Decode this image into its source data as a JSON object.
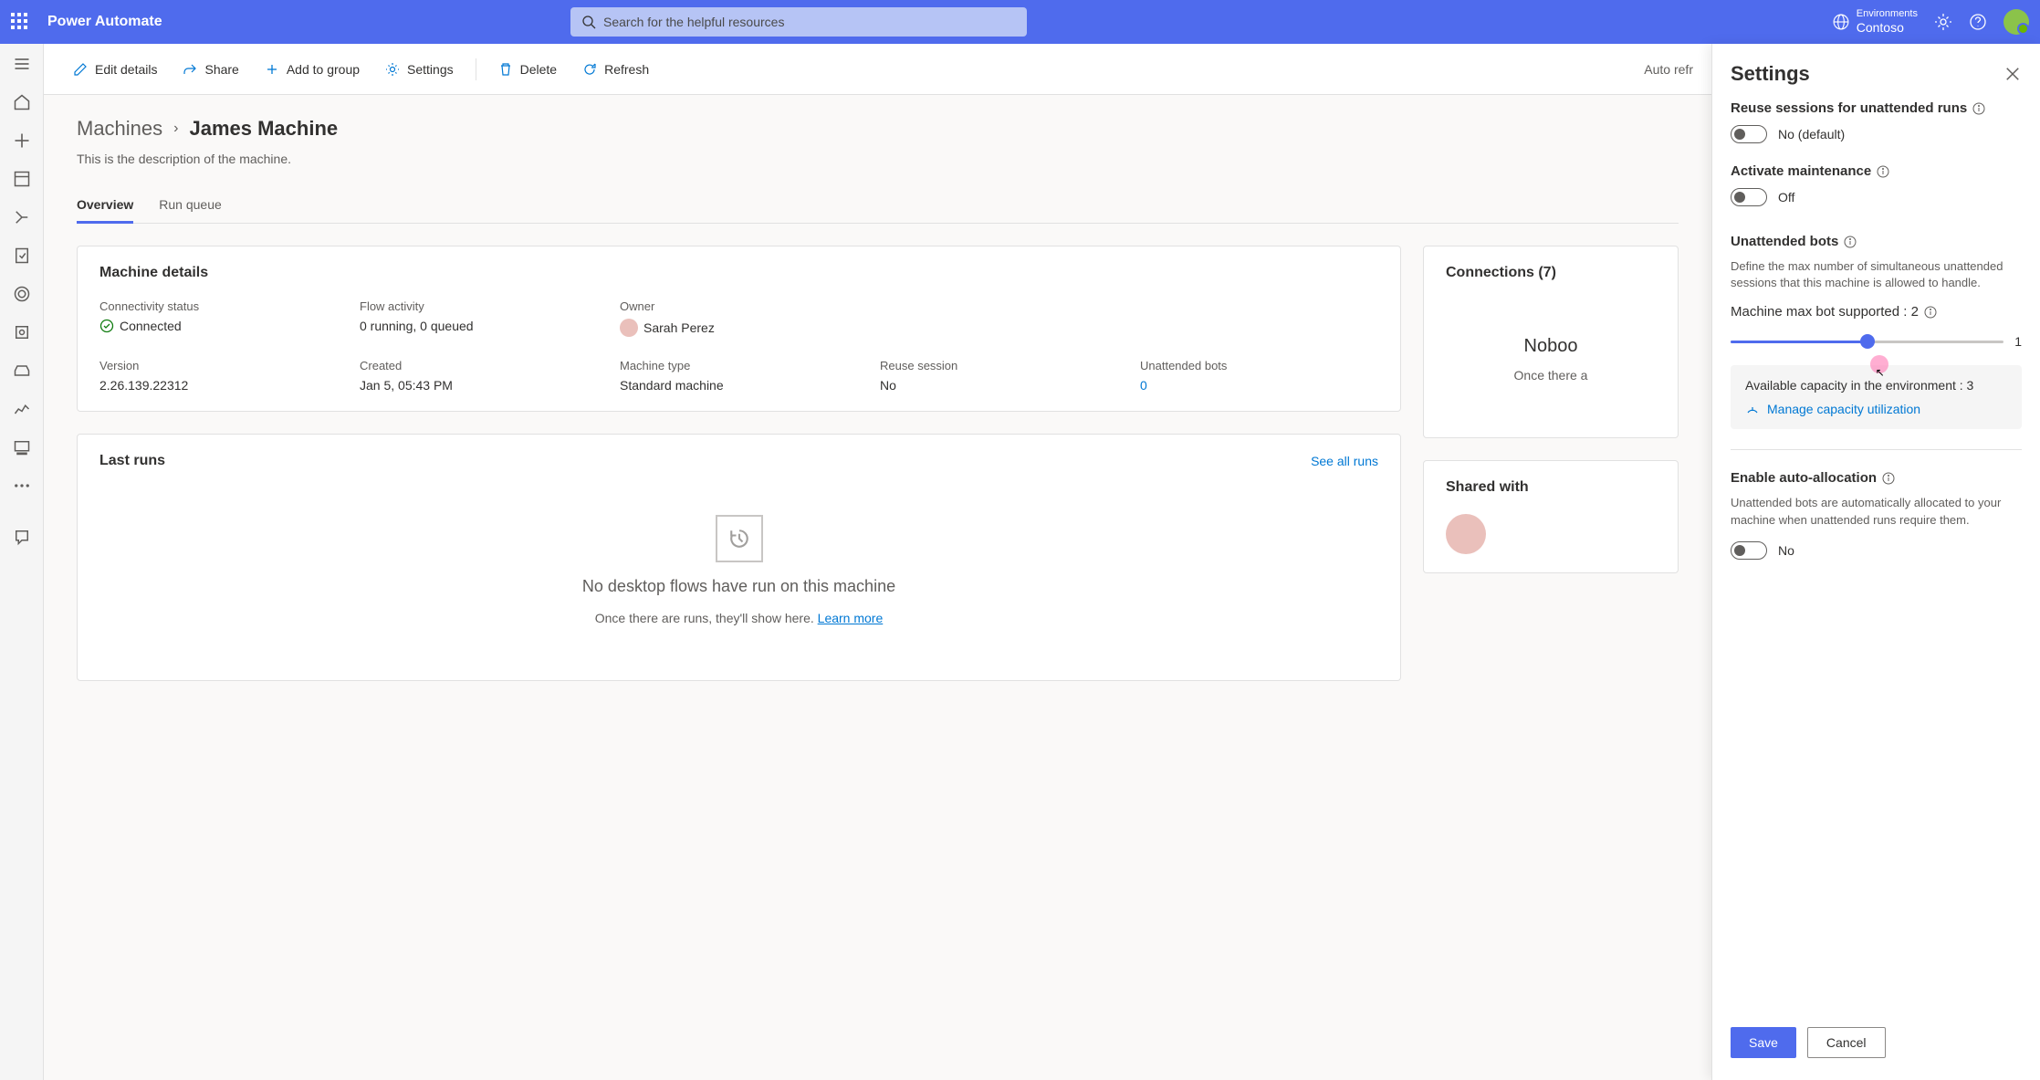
{
  "header": {
    "app_title": "Power Automate",
    "search_placeholder": "Search for the helpful resources",
    "env_label": "Environments",
    "env_name": "Contoso"
  },
  "command_bar": {
    "edit": "Edit details",
    "share": "Share",
    "add_group": "Add to group",
    "settings": "Settings",
    "delete": "Delete",
    "refresh": "Refresh",
    "auto_refresh": "Auto refr"
  },
  "breadcrumb": {
    "root": "Machines",
    "current": "James Machine"
  },
  "description": "This is the description of the machine.",
  "tabs": {
    "overview": "Overview",
    "run_queue": "Run queue"
  },
  "machine_details": {
    "title": "Machine details",
    "connectivity_label": "Connectivity status",
    "connectivity_value": "Connected",
    "flow_activity_label": "Flow activity",
    "flow_activity_value": "0 running, 0 queued",
    "owner_label": "Owner",
    "owner_value": "Sarah Perez",
    "version_label": "Version",
    "version_value": "2.26.139.22312",
    "created_label": "Created",
    "created_value": "Jan 5, 05:43 PM",
    "machine_type_label": "Machine type",
    "machine_type_value": "Standard machine",
    "reuse_label": "Reuse session",
    "reuse_value": "No",
    "unattended_label": "Unattended bots",
    "unattended_value": "0"
  },
  "connections": {
    "title": "Connections (7)",
    "nobody": "Noboo",
    "sub": "Once there a"
  },
  "last_runs": {
    "title": "Last runs",
    "see_all": "See all runs",
    "empty_title": "No desktop flows have run on this machine",
    "empty_sub": "Once there are runs, they'll show here. ",
    "learn_more": "Learn more"
  },
  "shared_with": {
    "title": "Shared with"
  },
  "settings_panel": {
    "title": "Settings",
    "reuse_sessions_label": "Reuse sessions for unattended runs",
    "reuse_sessions_value": "No (default)",
    "activate_maintenance_label": "Activate maintenance",
    "activate_maintenance_value": "Off",
    "unattended_bots_label": "Unattended bots",
    "unattended_bots_desc": "Define the max number of simultaneous unattended sessions that this machine is allowed to handle.",
    "max_bot_label": "Machine max bot supported : 2",
    "slider_value": "1",
    "capacity_label": "Available capacity in the environment : 3",
    "capacity_link": "Manage capacity utilization",
    "auto_alloc_label": "Enable auto-allocation",
    "auto_alloc_desc": "Unattended bots are automatically allocated to your machine when unattended runs require them.",
    "auto_alloc_value": "No",
    "save": "Save",
    "cancel": "Cancel"
  }
}
